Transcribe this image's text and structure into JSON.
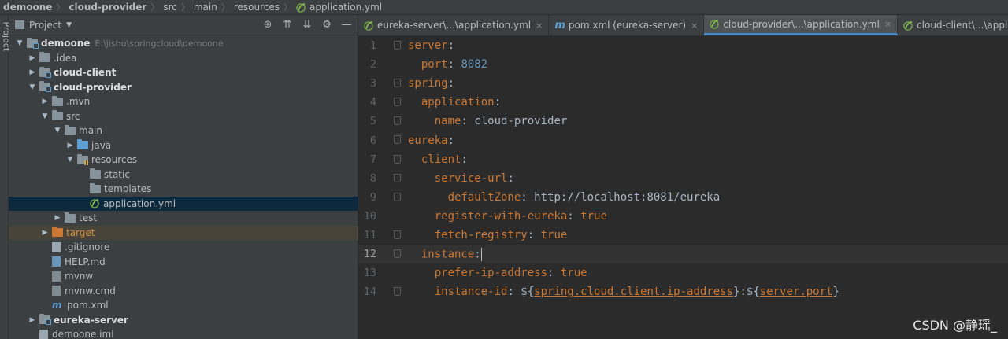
{
  "breadcrumb": {
    "items": [
      "demoone",
      "cloud-provider",
      "src",
      "main",
      "resources",
      "application.yml"
    ]
  },
  "sidebar_stripe": {
    "label": "Project"
  },
  "project_panel": {
    "title": "Project",
    "tree": [
      {
        "depth": 0,
        "arrow": "open",
        "icon": "module",
        "name": "demoone",
        "bold": true,
        "path": "E:\\jishu\\springcloud\\demoone"
      },
      {
        "depth": 1,
        "arrow": "closed",
        "icon": "folder",
        "name": ".idea"
      },
      {
        "depth": 1,
        "arrow": "closed",
        "icon": "module",
        "name": "cloud-client",
        "bold": true
      },
      {
        "depth": 1,
        "arrow": "open",
        "icon": "module",
        "name": "cloud-provider",
        "bold": true
      },
      {
        "depth": 2,
        "arrow": "closed",
        "icon": "folder",
        "name": ".mvn"
      },
      {
        "depth": 2,
        "arrow": "open",
        "icon": "folder",
        "name": "src"
      },
      {
        "depth": 3,
        "arrow": "open",
        "icon": "folder",
        "name": "main"
      },
      {
        "depth": 4,
        "arrow": "closed",
        "icon": "src",
        "name": "java"
      },
      {
        "depth": 4,
        "arrow": "open",
        "icon": "res",
        "name": "resources"
      },
      {
        "depth": 5,
        "arrow": "none",
        "icon": "folder",
        "name": "static"
      },
      {
        "depth": 5,
        "arrow": "none",
        "icon": "folder",
        "name": "templates"
      },
      {
        "depth": 5,
        "arrow": "none",
        "icon": "yml",
        "name": "application.yml",
        "selected": true
      },
      {
        "depth": 3,
        "arrow": "closed",
        "icon": "folder",
        "name": "test"
      },
      {
        "depth": 2,
        "arrow": "closed",
        "icon": "target",
        "name": "target",
        "target": true
      },
      {
        "depth": 2,
        "arrow": "none",
        "icon": "gitignore",
        "name": ".gitignore"
      },
      {
        "depth": 2,
        "arrow": "none",
        "icon": "md",
        "name": "HELP.md"
      },
      {
        "depth": 2,
        "arrow": "none",
        "icon": "cmd",
        "name": "mvnw"
      },
      {
        "depth": 2,
        "arrow": "none",
        "icon": "cmd",
        "name": "mvnw.cmd"
      },
      {
        "depth": 2,
        "arrow": "none",
        "icon": "m",
        "name": "pom.xml"
      },
      {
        "depth": 1,
        "arrow": "closed",
        "icon": "module",
        "name": "eureka-server",
        "bold": true
      },
      {
        "depth": 1,
        "arrow": "none",
        "icon": "iml",
        "name": "demoone.iml"
      }
    ]
  },
  "tabs": [
    {
      "label": "eureka-server\\...\\application.yml",
      "icon": "yml",
      "active": false
    },
    {
      "label": "pom.xml (eureka-server)",
      "icon": "m",
      "active": false
    },
    {
      "label": "cloud-provider\\...\\application.yml",
      "icon": "yml",
      "active": true
    },
    {
      "label": "cloud-client\\...\\application.yml",
      "icon": "yml",
      "active": false
    }
  ],
  "code_lines": [
    {
      "num": "1",
      "indent": "",
      "key": "server",
      "sep": ":",
      "val": "",
      "fold": true
    },
    {
      "num": "2",
      "indent": "  ",
      "key": "port",
      "sep": ": ",
      "val": "8082",
      "valtype": "num"
    },
    {
      "num": "3",
      "indent": "",
      "key": "spring",
      "sep": ":",
      "val": "",
      "fold": true
    },
    {
      "num": "4",
      "indent": "  ",
      "key": "application",
      "sep": ":",
      "val": "",
      "fold": true
    },
    {
      "num": "5",
      "indent": "    ",
      "key": "name",
      "sep": ": ",
      "val": "cloud-provider",
      "valtype": "str",
      "fold": true
    },
    {
      "num": "6",
      "indent": "",
      "key": "eureka",
      "sep": ":",
      "val": "",
      "fold": true
    },
    {
      "num": "7",
      "indent": "  ",
      "key": "client",
      "sep": ":",
      "val": "",
      "fold": true
    },
    {
      "num": "8",
      "indent": "    ",
      "key": "service-url",
      "sep": ":",
      "val": "",
      "fold": true
    },
    {
      "num": "9",
      "indent": "      ",
      "key": "defaultZone",
      "sep": ": ",
      "val": "http://localhost:8081/eureka",
      "valtype": "str",
      "fold": true
    },
    {
      "num": "10",
      "indent": "    ",
      "key": "register-with-eureka",
      "sep": ": ",
      "val": "true",
      "valtype": "kw"
    },
    {
      "num": "11",
      "indent": "    ",
      "key": "fetch-registry",
      "sep": ": ",
      "val": "true",
      "valtype": "kw",
      "fold": true
    },
    {
      "num": "12",
      "indent": "  ",
      "key": "instance",
      "sep": ":",
      "val": "",
      "fold": true,
      "current": true
    },
    {
      "num": "13",
      "indent": "    ",
      "key": "prefer-ip-address",
      "sep": ": ",
      "val": "true",
      "valtype": "kw"
    },
    {
      "num": "14",
      "indent": "    ",
      "key": "instance-id",
      "sep": ": ",
      "val": "",
      "valtype": "ref",
      "fold": true,
      "ref_parts": [
        "${",
        "spring.cloud.client.ip-address",
        "}:${",
        "server.port",
        "}"
      ]
    }
  ],
  "watermark": "CSDN @静瑶_",
  "colors": {
    "key": "#cc7832",
    "number": "#6897bb",
    "text": "#a9b7c6",
    "selection": "#0d293e",
    "accent": "#4a88c7"
  }
}
